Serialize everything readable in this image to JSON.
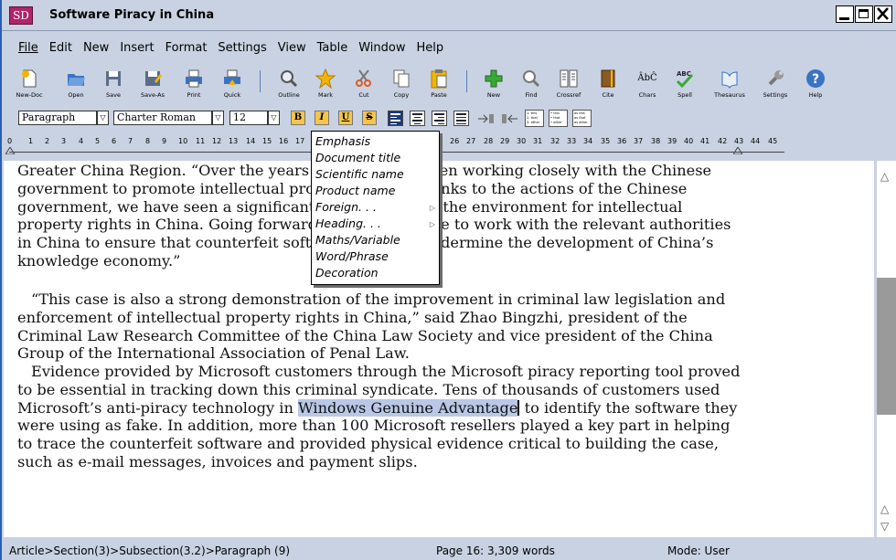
{
  "window": {
    "title": "Software Piracy in China",
    "app_icon": "SD"
  },
  "menu": [
    "File",
    "Edit",
    "New",
    "Insert",
    "Format",
    "Settings",
    "View",
    "Table",
    "Window",
    "Help"
  ],
  "toolbar": {
    "new_doc": "New-Doc",
    "open": "Open",
    "save": "Save",
    "save_as": "Save-As",
    "print": "Print",
    "quick": "Quick",
    "outline": "Outline",
    "mark": "Mark",
    "cut": "Cut",
    "copy": "Copy",
    "paste": "Paste",
    "new": "New",
    "find": "Find",
    "crossref": "Crossref",
    "cite": "Cite",
    "chars": "Chars",
    "spell": "Spell",
    "thesaurus": "Thesaurus",
    "settings": "Settings",
    "help": "Help"
  },
  "format": {
    "style": "Paragraph",
    "font": "Charter Roman",
    "size": "12",
    "bold": "B",
    "italic": "I",
    "underline": "U",
    "strike": "S",
    "list1": [
      "1. this",
      "2. that",
      "3. other"
    ],
    "list2": [
      "• this",
      "• that",
      "• other"
    ],
    "list3": [
      "as this",
      "as that",
      "as other"
    ]
  },
  "ruler": {
    "ticks": [
      "0",
      "1",
      "2",
      "3",
      "4",
      "5",
      "6",
      "7",
      "8",
      "9",
      "10",
      "11",
      "12",
      "13",
      "14",
      "15",
      "16",
      "17",
      "26",
      "27",
      "28",
      "29",
      "30",
      "31",
      "32",
      "33",
      "34",
      "35",
      "36",
      "37",
      "38",
      "39",
      "40",
      "41",
      "42",
      "43",
      "44",
      "45"
    ]
  },
  "popup": {
    "items": [
      "Emphasis",
      "Document title",
      "Scientific name",
      "Product name",
      "Foreign. . .",
      "Heading. . .",
      "Maths/Variable",
      "Word/Phrase",
      "Decoration"
    ],
    "arrow": "▷"
  },
  "document": {
    "p1": "Greater China Region. “Over the years Microsoft has been working closely with the Chinese government to promote intellectual property rights. Thanks to the actions of the Chinese government, we have seen a significant improvement in the environment for intellectual property rights in China. Going forward, we will continue to work with the relevant authorities in China to ensure that counterfeit software does not undermine the development of China’s knowledge economy.”",
    "p2": "“This case is also a strong demonstration of the improvement in criminal law legislation and enforcement of intellectual property rights in China,” said Zhao Bingzhi, president of the Criminal Law Research Committee of the China Law Society and vice president of the China Group of the International Association of Penal Law.",
    "p3_before": "Evidence provided by Microsoft customers through the Microsoft piracy reporting tool proved to be essential in tracking down this criminal syndicate. Tens of thousands of customers used Microsoft’s anti-piracy technology in ",
    "p3_highlight": "Windows Genuine Advantage",
    "p3_after": " to identify the software they were using as fake. In addition, more than 100 Microsoft resellers played a key part in helping to trace the counterfeit software and provided physical evidence critical to building the case, such as e-mail messages, invoices and payment slips."
  },
  "status": {
    "path": "Article>Section(3)>Subsection(3.2)>Paragraph (9)",
    "page": "Page 16: 3,309 words",
    "mode": "Mode: User"
  }
}
